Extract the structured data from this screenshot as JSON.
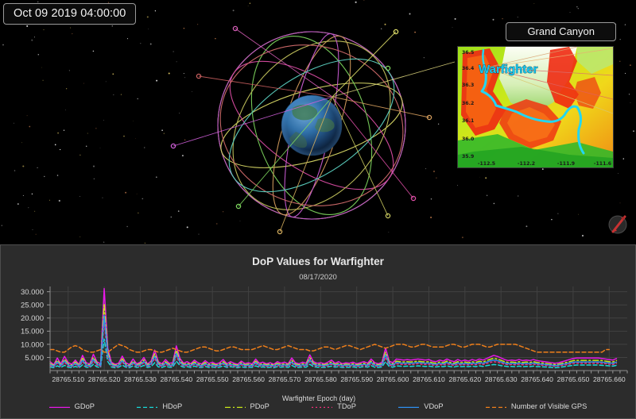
{
  "scene": {
    "timestamp": "Oct 09 2019 04:00:00",
    "globe_name": "earth-globe",
    "compass_name": "compass-widget"
  },
  "inset": {
    "title": "Grand Canyon",
    "marker_label": "Warfighter",
    "lat_ticks": [
      "36.5",
      "36.4",
      "36.3",
      "36.2",
      "36.1",
      "36.0",
      "35.9"
    ],
    "lon_ticks": [
      "-112.5",
      "-112.2",
      "-111.9",
      "-111.6"
    ]
  },
  "chart": {
    "title": "DoP Values for Warfighter",
    "subtitle": "08/17/2020"
  },
  "chart_data": {
    "type": "line",
    "title": "DoP Values for Warfighter",
    "subtitle": "08/17/2020",
    "xlabel": "Warfighter Epoch (day)",
    "ylabel": "",
    "xlim": [
      28765.505,
      28765.665
    ],
    "ylim": [
      0,
      32
    ],
    "grid": true,
    "legend_position": "bottom",
    "ytick_labels": [
      "5.000",
      "10.000",
      "15.000",
      "20.000",
      "25.000",
      "30.000"
    ],
    "ytick_values": [
      5,
      10,
      15,
      20,
      25,
      30
    ],
    "xtick_labels": [
      "28765.510",
      "28765.520",
      "28765.530",
      "28765.540",
      "28765.550",
      "28765.560",
      "28765.570",
      "28765.580",
      "28765.590",
      "28765.600",
      "28765.610",
      "28765.620",
      "28765.630",
      "28765.640",
      "28765.650",
      "28765.660"
    ],
    "xtick_values": [
      28765.51,
      28765.52,
      28765.53,
      28765.54,
      28765.55,
      28765.56,
      28765.57,
      28765.58,
      28765.59,
      28765.6,
      28765.61,
      28765.62,
      28765.63,
      28765.64,
      28765.65,
      28765.66
    ],
    "x": [
      28765.505,
      28765.506,
      28765.507,
      28765.508,
      28765.509,
      28765.51,
      28765.511,
      28765.512,
      28765.513,
      28765.514,
      28765.515,
      28765.516,
      28765.517,
      28765.518,
      28765.519,
      28765.52,
      28765.521,
      28765.522,
      28765.523,
      28765.524,
      28765.525,
      28765.526,
      28765.527,
      28765.528,
      28765.529,
      28765.53,
      28765.531,
      28765.532,
      28765.533,
      28765.534,
      28765.535,
      28765.536,
      28765.537,
      28765.538,
      28765.539,
      28765.54,
      28765.541,
      28765.542,
      28765.543,
      28765.544,
      28765.545,
      28765.546,
      28765.547,
      28765.548,
      28765.549,
      28765.55,
      28765.551,
      28765.552,
      28765.553,
      28765.554,
      28765.555,
      28765.556,
      28765.557,
      28765.558,
      28765.559,
      28765.56,
      28765.561,
      28765.562,
      28765.563,
      28765.564,
      28765.565,
      28765.566,
      28765.567,
      28765.568,
      28765.569,
      28765.57,
      28765.571,
      28765.572,
      28765.573,
      28765.574,
      28765.575,
      28765.576,
      28765.577,
      28765.578,
      28765.579,
      28765.58,
      28765.581,
      28765.582,
      28765.583,
      28765.584,
      28765.585,
      28765.586,
      28765.587,
      28765.588,
      28765.589,
      28765.59,
      28765.591,
      28765.592,
      28765.593,
      28765.594,
      28765.595,
      28765.596,
      28765.597,
      28765.598,
      28765.599,
      28765.6,
      28765.601,
      28765.602,
      28765.603,
      28765.604,
      28765.605,
      28765.606,
      28765.607,
      28765.608,
      28765.609,
      28765.61,
      28765.611,
      28765.612,
      28765.613,
      28765.614,
      28765.615,
      28765.616,
      28765.617,
      28765.618,
      28765.619,
      28765.62,
      28765.621,
      28765.622,
      28765.623,
      28765.624,
      28765.625,
      28765.626,
      28765.627,
      28765.628,
      28765.629,
      28765.63,
      28765.631,
      28765.632,
      28765.633,
      28765.634,
      28765.635,
      28765.636,
      28765.637,
      28765.638,
      28765.639,
      28765.64,
      28765.641,
      28765.642,
      28765.643,
      28765.644,
      28765.645,
      28765.646,
      28765.647,
      28765.648,
      28765.649,
      28765.65,
      28765.651,
      28765.652,
      28765.653,
      28765.654,
      28765.655,
      28765.656,
      28765.657,
      28765.658,
      28765.659,
      28765.66,
      28765.661,
      28765.662,
      28765.663,
      28765.664,
      28765.665
    ],
    "series": [
      {
        "name": "GDoP",
        "color": "#e619e6",
        "dash": "none",
        "values": [
          3.4,
          2.2,
          4.8,
          2.6,
          5.4,
          3.1,
          2.4,
          4.0,
          2.3,
          5.8,
          3.0,
          2.5,
          6.2,
          3.3,
          2.6,
          31.2,
          8.5,
          3.2,
          2.4,
          2.8,
          5.5,
          3.0,
          2.3,
          4.4,
          2.6,
          3.2,
          5.0,
          2.5,
          3.6,
          7.8,
          3.4,
          2.6,
          4.2,
          2.8,
          3.0,
          9.4,
          4.6,
          2.8,
          3.4,
          2.6,
          4.0,
          3.0,
          2.5,
          3.8,
          2.7,
          3.2,
          2.5,
          3.0,
          4.2,
          2.6,
          3.4,
          2.8,
          2.4,
          3.6,
          2.7,
          3.0,
          2.5,
          4.4,
          2.8,
          3.2,
          2.6,
          3.0,
          2.4,
          3.4,
          2.8,
          3.2,
          2.6,
          4.8,
          3.0,
          2.6,
          3.2,
          2.8,
          6.0,
          3.4,
          2.8,
          3.0,
          2.6,
          3.2,
          4.0,
          2.8,
          3.4,
          2.6,
          3.0,
          2.8,
          3.2,
          2.6,
          3.0,
          3.4,
          2.8,
          4.4,
          3.0,
          2.6,
          3.2,
          8.6,
          3.6,
          3.0,
          4.4,
          4.2,
          4.0,
          4.2,
          4.0,
          4.2,
          4.4,
          4.2,
          4.0,
          4.2,
          3.6,
          3.4,
          4.0,
          3.6,
          4.4,
          3.8,
          3.4,
          4.2,
          3.6,
          4.0,
          3.6,
          4.2,
          3.8,
          4.4,
          4.0,
          4.6,
          5.2,
          5.8,
          5.4,
          4.8,
          4.2,
          3.8,
          4.0,
          3.8,
          4.2,
          3.8,
          4.0,
          3.8,
          4.2,
          3.8,
          3.6,
          3.4,
          3.2,
          3.0,
          2.8,
          3.0,
          3.4,
          3.8,
          4.2,
          4.6,
          4.8,
          4.8,
          4.8,
          4.8,
          4.8,
          4.8,
          4.8,
          4.6,
          4.4,
          4.2,
          4.0,
          4.6
        ]
      },
      {
        "name": "HDoP",
        "color": "#18d8d8",
        "dash": "5,3",
        "values": [
          1.4,
          1.1,
          1.8,
          1.2,
          2.0,
          1.3,
          1.1,
          1.6,
          1.1,
          2.2,
          1.3,
          1.2,
          2.4,
          1.4,
          1.2,
          12.0,
          3.4,
          1.4,
          1.1,
          1.3,
          2.1,
          1.3,
          1.1,
          1.8,
          1.2,
          1.4,
          2.0,
          1.2,
          1.5,
          3.0,
          1.4,
          1.2,
          1.7,
          1.3,
          1.3,
          3.6,
          1.9,
          1.3,
          1.5,
          1.2,
          1.7,
          1.3,
          1.2,
          1.6,
          1.2,
          1.4,
          1.2,
          1.3,
          1.8,
          1.2,
          1.5,
          1.3,
          1.1,
          1.5,
          1.2,
          1.3,
          1.2,
          1.8,
          1.3,
          1.4,
          1.2,
          1.3,
          1.1,
          1.5,
          1.3,
          1.4,
          1.2,
          2.0,
          1.3,
          1.2,
          1.4,
          1.3,
          2.4,
          1.5,
          1.3,
          1.3,
          1.2,
          1.4,
          1.7,
          1.3,
          1.5,
          1.2,
          1.3,
          1.3,
          1.4,
          1.2,
          1.3,
          1.5,
          1.3,
          1.9,
          1.3,
          1.2,
          1.4,
          3.4,
          1.6,
          1.3,
          1.8,
          1.7,
          1.6,
          1.7,
          1.6,
          1.7,
          1.8,
          1.7,
          1.6,
          1.7,
          1.5,
          1.4,
          1.6,
          1.5,
          1.8,
          1.5,
          1.4,
          1.7,
          1.5,
          1.6,
          1.5,
          1.7,
          1.5,
          1.8,
          1.6,
          1.9,
          2.1,
          2.3,
          2.2,
          1.9,
          1.7,
          1.5,
          1.6,
          1.5,
          1.7,
          1.5,
          1.6,
          1.5,
          1.7,
          1.5,
          1.5,
          1.4,
          1.3,
          1.2,
          1.1,
          1.2,
          1.4,
          1.6,
          1.8,
          2.0,
          2.1,
          2.1,
          2.1,
          2.1,
          2.1,
          2.1,
          2.1,
          2.0,
          1.9,
          1.8,
          1.7,
          2.0
        ]
      },
      {
        "name": "PDoP",
        "color": "#c8e619",
        "dash": "7,3,2,3",
        "values": [
          2.8,
          1.9,
          3.9,
          2.2,
          4.3,
          2.6,
          2.0,
          3.3,
          2.0,
          4.7,
          2.5,
          2.1,
          5.0,
          2.8,
          2.2,
          25.5,
          7.0,
          2.7,
          2.0,
          2.3,
          4.5,
          2.5,
          1.9,
          3.6,
          2.2,
          2.7,
          4.1,
          2.1,
          3.0,
          6.4,
          2.8,
          2.2,
          3.4,
          2.3,
          2.5,
          7.7,
          3.8,
          2.3,
          2.8,
          2.2,
          3.3,
          2.5,
          2.1,
          3.1,
          2.2,
          2.6,
          2.1,
          2.5,
          3.4,
          2.2,
          2.8,
          2.3,
          2.0,
          3.0,
          2.2,
          2.5,
          2.1,
          3.6,
          2.3,
          2.6,
          2.2,
          2.5,
          2.0,
          2.8,
          2.3,
          2.6,
          2.2,
          3.9,
          2.5,
          2.2,
          2.6,
          2.3,
          4.9,
          2.8,
          2.3,
          2.5,
          2.2,
          2.6,
          3.3,
          2.3,
          2.8,
          2.2,
          2.5,
          2.3,
          2.6,
          2.2,
          2.5,
          2.8,
          2.3,
          3.6,
          2.5,
          2.2,
          2.6,
          7.0,
          3.0,
          2.5,
          3.6,
          3.4,
          3.3,
          3.4,
          3.3,
          3.4,
          3.6,
          3.4,
          3.3,
          3.4,
          3.0,
          2.8,
          3.3,
          3.0,
          3.6,
          3.1,
          2.8,
          3.4,
          3.0,
          3.3,
          3.0,
          3.4,
          3.1,
          3.6,
          3.3,
          3.8,
          4.3,
          4.7,
          4.4,
          3.9,
          3.4,
          3.1,
          3.3,
          3.1,
          3.4,
          3.1,
          3.3,
          3.1,
          3.4,
          3.1,
          3.0,
          2.8,
          2.6,
          2.5,
          2.3,
          2.5,
          2.8,
          3.1,
          3.4,
          3.8,
          3.9,
          3.9,
          3.9,
          3.9,
          3.9,
          3.9,
          3.9,
          3.8,
          3.6,
          3.4,
          3.3,
          3.8
        ]
      },
      {
        "name": "TDoP",
        "color": "#f0307a",
        "dash": "2,3",
        "values": [
          2.0,
          1.4,
          2.8,
          1.6,
          3.1,
          1.8,
          1.5,
          2.4,
          1.4,
          3.4,
          1.8,
          1.5,
          3.6,
          2.0,
          1.6,
          18.5,
          5.0,
          1.9,
          1.4,
          1.7,
          3.2,
          1.8,
          1.4,
          2.6,
          1.6,
          1.9,
          3.0,
          1.5,
          2.2,
          4.6,
          2.0,
          1.6,
          2.5,
          1.7,
          1.8,
          5.5,
          2.7,
          1.7,
          2.0,
          1.6,
          2.4,
          1.8,
          1.5,
          2.2,
          1.6,
          1.9,
          1.5,
          1.8,
          2.5,
          1.6,
          2.0,
          1.7,
          1.4,
          2.2,
          1.6,
          1.8,
          1.5,
          2.6,
          1.7,
          1.9,
          1.6,
          1.8,
          1.4,
          2.0,
          1.7,
          1.9,
          1.6,
          2.8,
          1.8,
          1.6,
          1.9,
          1.7,
          3.5,
          2.0,
          1.7,
          1.8,
          1.6,
          1.9,
          2.4,
          1.7,
          2.0,
          1.6,
          1.8,
          1.7,
          1.9,
          1.6,
          1.8,
          2.0,
          1.7,
          2.6,
          1.8,
          1.6,
          1.9,
          5.0,
          2.1,
          1.8,
          2.6,
          2.4,
          2.3,
          2.4,
          2.3,
          2.4,
          2.6,
          2.4,
          2.3,
          2.4,
          2.1,
          2.0,
          2.3,
          2.1,
          2.6,
          2.2,
          2.0,
          2.4,
          2.1,
          2.3,
          2.1,
          2.4,
          2.2,
          2.6,
          2.3,
          2.7,
          3.1,
          3.4,
          3.2,
          2.8,
          2.4,
          2.2,
          2.3,
          2.2,
          2.4,
          2.2,
          2.3,
          2.2,
          2.4,
          2.2,
          2.1,
          2.0,
          1.9,
          1.8,
          1.6,
          1.8,
          2.0,
          2.2,
          2.4,
          2.7,
          2.8,
          2.8,
          2.8,
          2.8,
          2.8,
          2.8,
          2.8,
          2.7,
          2.6,
          2.4,
          2.3,
          2.7
        ]
      },
      {
        "name": "VDoP",
        "color": "#2f8ff0",
        "dash": "none",
        "values": [
          2.4,
          1.6,
          3.3,
          1.9,
          3.7,
          2.2,
          1.7,
          2.8,
          1.7,
          4.0,
          2.1,
          1.8,
          4.3,
          2.4,
          1.9,
          21.0,
          6.0,
          2.3,
          1.7,
          2.0,
          3.8,
          2.1,
          1.6,
          3.1,
          1.9,
          2.3,
          3.5,
          1.8,
          2.6,
          5.4,
          2.4,
          1.9,
          2.9,
          2.0,
          2.1,
          6.5,
          3.2,
          2.0,
          2.4,
          1.9,
          2.8,
          2.1,
          1.8,
          2.6,
          1.9,
          2.2,
          1.8,
          2.1,
          2.9,
          1.9,
          2.4,
          2.0,
          1.7,
          2.6,
          1.9,
          2.1,
          1.8,
          3.1,
          2.0,
          2.2,
          1.9,
          2.1,
          1.7,
          2.4,
          2.0,
          2.2,
          1.9,
          3.3,
          2.1,
          1.9,
          2.2,
          2.0,
          4.2,
          2.4,
          2.0,
          2.1,
          1.9,
          2.2,
          2.8,
          2.0,
          2.4,
          1.9,
          2.1,
          2.0,
          2.2,
          1.9,
          2.1,
          2.4,
          2.0,
          3.1,
          2.1,
          1.9,
          2.2,
          6.0,
          2.6,
          2.1,
          3.1,
          2.9,
          2.8,
          2.9,
          2.8,
          2.9,
          3.1,
          2.9,
          2.8,
          2.9,
          2.5,
          2.4,
          2.8,
          2.5,
          3.1,
          2.6,
          2.4,
          2.9,
          2.5,
          2.8,
          2.5,
          2.9,
          2.6,
          3.1,
          2.8,
          3.2,
          3.7,
          4.0,
          3.8,
          3.3,
          2.9,
          2.6,
          2.8,
          2.6,
          2.9,
          2.6,
          2.8,
          2.6,
          2.9,
          2.6,
          2.5,
          2.4,
          2.2,
          2.1,
          1.9,
          2.1,
          2.4,
          2.6,
          2.9,
          3.2,
          3.3,
          3.3,
          3.3,
          3.3,
          3.3,
          3.3,
          3.3,
          3.2,
          3.0,
          2.9,
          2.8,
          3.2
        ]
      },
      {
        "name": "Number of Visible GPS",
        "color": "#ef7f1a",
        "dash": "5,3",
        "values": [
          8.0,
          8.0,
          7.5,
          7.0,
          7.0,
          8.0,
          9.0,
          9.5,
          9.0,
          8.0,
          7.5,
          7.0,
          7.0,
          7.5,
          8.0,
          7.0,
          7.0,
          8.0,
          9.0,
          10.0,
          9.5,
          9.0,
          8.0,
          7.5,
          7.0,
          7.0,
          7.5,
          8.0,
          8.0,
          7.5,
          7.0,
          7.0,
          7.5,
          8.0,
          8.5,
          8.0,
          7.5,
          7.0,
          7.0,
          7.5,
          8.0,
          8.5,
          9.0,
          9.0,
          8.5,
          8.0,
          7.5,
          7.5,
          8.0,
          8.5,
          9.0,
          9.0,
          8.5,
          8.0,
          8.0,
          8.0,
          8.0,
          8.5,
          9.0,
          9.5,
          9.0,
          8.5,
          8.0,
          8.0,
          8.5,
          9.0,
          9.5,
          9.0,
          8.5,
          8.0,
          8.0,
          8.0,
          7.5,
          7.5,
          8.0,
          8.5,
          9.0,
          9.0,
          8.5,
          8.0,
          8.5,
          9.0,
          9.5,
          9.5,
          9.0,
          8.5,
          8.0,
          8.5,
          9.0,
          9.5,
          10.0,
          9.5,
          9.0,
          8.5,
          9.0,
          9.5,
          10.0,
          10.0,
          10.0,
          9.5,
          9.0,
          9.0,
          9.5,
          10.0,
          10.0,
          9.5,
          9.0,
          9.0,
          9.0,
          9.0,
          9.5,
          10.0,
          10.0,
          9.5,
          9.0,
          9.0,
          9.5,
          10.0,
          10.0,
          10.0,
          9.5,
          9.0,
          9.0,
          9.5,
          10.0,
          10.0,
          10.0,
          10.0,
          10.0,
          10.0,
          9.5,
          9.0,
          8.5,
          8.0,
          7.5,
          7.0,
          7.0,
          7.0,
          7.0,
          7.0,
          7.0,
          7.0,
          7.0,
          7.0,
          7.0,
          7.0,
          7.0,
          7.0,
          7.0,
          7.0,
          7.0,
          7.0,
          7.0,
          7.0,
          8.0,
          8.0
        ]
      }
    ]
  },
  "legend": [
    {
      "label": "GDoP",
      "color": "#e619e6",
      "dash": "none"
    },
    {
      "label": "HDoP",
      "color": "#18d8d8",
      "dash": "5,3"
    },
    {
      "label": "PDoP",
      "color": "#c8e619",
      "dash": "7,3,2,3"
    },
    {
      "label": "TDoP",
      "color": "#f0307a",
      "dash": "2,3"
    },
    {
      "label": "VDoP",
      "color": "#2f8ff0",
      "dash": "none"
    },
    {
      "label": "Number of Visible GPS",
      "color": "#ef7f1a",
      "dash": "5,3"
    }
  ]
}
